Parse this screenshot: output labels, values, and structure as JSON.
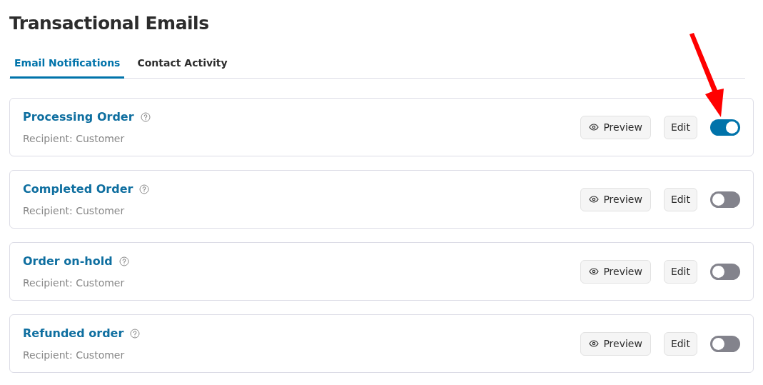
{
  "title": "Transactional Emails",
  "tabs": [
    {
      "label": "Email Notifications",
      "selected": true
    },
    {
      "label": "Contact Activity",
      "selected": false
    }
  ],
  "emails": [
    {
      "name": "Processing Order",
      "recipient": "Recipient: Customer",
      "preview": "Preview",
      "edit": "Edit",
      "on": true
    },
    {
      "name": "Completed Order",
      "recipient": "Recipient: Customer",
      "preview": "Preview",
      "edit": "Edit",
      "on": false
    },
    {
      "name": "Order on-hold",
      "recipient": "Recipient: Customer",
      "preview": "Preview",
      "edit": "Edit",
      "on": false
    },
    {
      "name": "Refunded order",
      "recipient": "Recipient: Customer",
      "preview": "Preview",
      "edit": "Edit",
      "on": false
    }
  ]
}
